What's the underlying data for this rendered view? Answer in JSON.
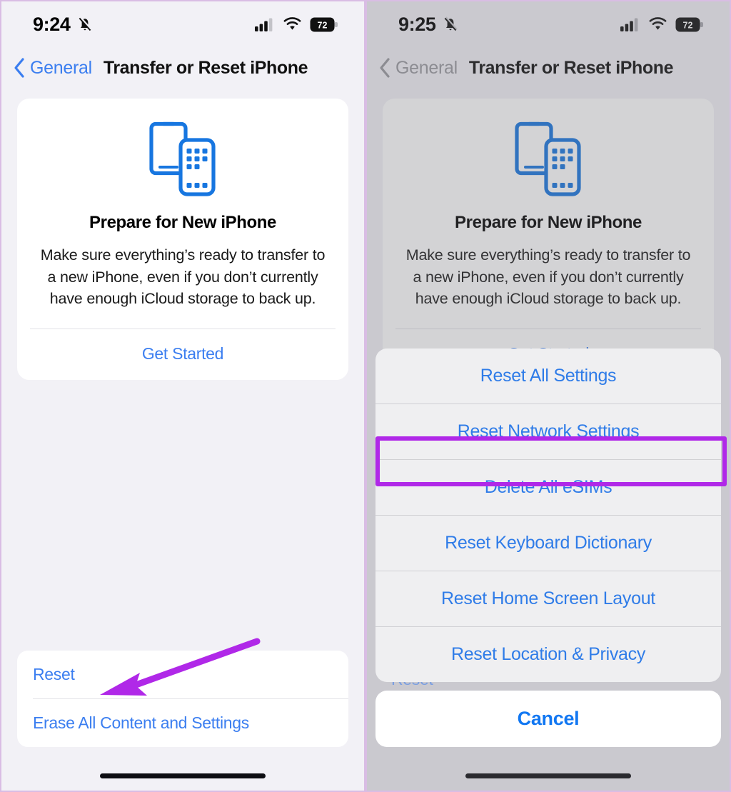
{
  "annotations": {
    "highlight_color": "#b028e8",
    "arrow_color": "#b028e8",
    "highlight_target": "Reset Network Settings",
    "arrow_target": "Reset"
  },
  "left_panel": {
    "status_bar": {
      "time": "9:24",
      "silent_icon": "bell-slash-icon",
      "signal_icon": "cellular-signal-icon",
      "wifi_icon": "wifi-icon",
      "battery_icon": "battery-icon",
      "battery_level": "72"
    },
    "nav": {
      "back_icon": "chevron-left-icon",
      "back_label": "General",
      "title": "Transfer or Reset iPhone"
    },
    "card": {
      "icon": "two-iphones-icon",
      "title": "Prepare for New iPhone",
      "description": "Make sure everything’s ready to transfer to a new iPhone, even if you don’t currently have enough iCloud storage to back up.",
      "action_label": "Get Started"
    },
    "bottom_group": {
      "items": [
        {
          "label": "Reset"
        },
        {
          "label": "Erase All Content and Settings"
        }
      ]
    }
  },
  "right_panel": {
    "status_bar": {
      "time": "9:25",
      "silent_icon": "bell-slash-icon",
      "signal_icon": "cellular-signal-icon",
      "wifi_icon": "wifi-icon",
      "battery_icon": "battery-icon",
      "battery_level": "72"
    },
    "nav": {
      "back_icon": "chevron-left-icon",
      "back_label": "General",
      "title": "Transfer or Reset iPhone"
    },
    "card": {
      "icon": "two-iphones-icon",
      "title": "Prepare for New iPhone",
      "description": "Make sure everything’s ready to transfer to a new iPhone, even if you don’t currently have enough iCloud storage to back up.",
      "action_label": "Get Started"
    },
    "ghost_row_label": "Reset",
    "action_sheet": {
      "items": [
        {
          "label": "Reset All Settings",
          "highlighted": false
        },
        {
          "label": "Reset Network Settings",
          "highlighted": true
        },
        {
          "label": "Delete All eSIMs",
          "highlighted": false
        },
        {
          "label": "Reset Keyboard Dictionary",
          "highlighted": false
        },
        {
          "label": "Reset Home Screen Layout",
          "highlighted": false
        },
        {
          "label": "Reset Location & Privacy",
          "highlighted": false
        }
      ],
      "cancel_label": "Cancel"
    }
  }
}
